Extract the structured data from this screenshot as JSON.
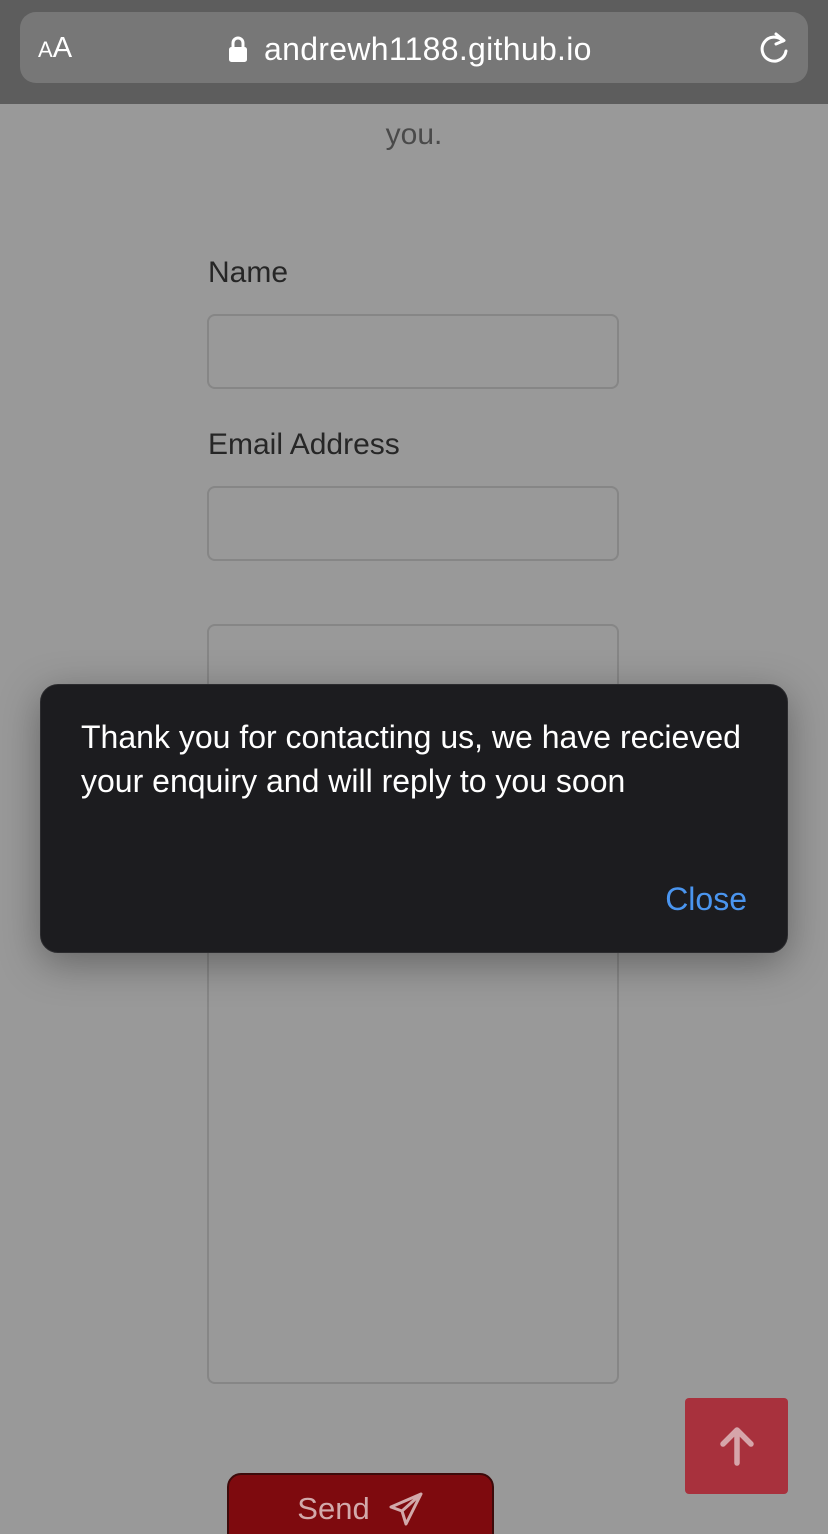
{
  "browser": {
    "text_size_button": {
      "small": "A",
      "large": "A"
    },
    "url": "andrewh1188.github.io",
    "icons": {
      "lock": "lock-icon",
      "reload": "reload-icon"
    }
  },
  "page": {
    "intro_tail": "you.",
    "form": {
      "name_label": "Name",
      "name_value": "",
      "email_label": "Email Address",
      "email_value": "",
      "message_value": "",
      "send_label": "Send",
      "send_icon": "paper-plane-icon"
    },
    "scroll_top_icon": "arrow-up-icon",
    "colors": {
      "send_button": "#7e0a0e",
      "scroll_top_button": "#a8313d",
      "overlay": "#999999"
    }
  },
  "alert": {
    "message": "Thank you for contacting us, we have recieved your enquiry and will reply to you soon",
    "close_label": "Close",
    "colors": {
      "background": "#1c1c1f",
      "link": "#4a95ef"
    }
  }
}
